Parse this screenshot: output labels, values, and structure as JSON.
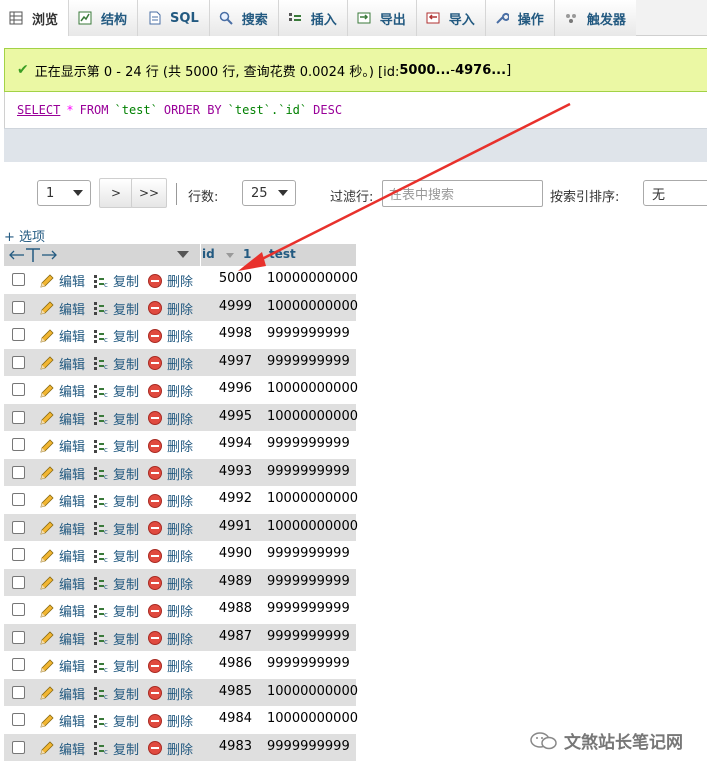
{
  "tabs": [
    {
      "label": "浏览",
      "icon": "browse-icon",
      "active": true
    },
    {
      "label": "结构",
      "icon": "structure-icon"
    },
    {
      "label": "SQL",
      "icon": "sql-icon"
    },
    {
      "label": "搜索",
      "icon": "search-icon"
    },
    {
      "label": "插入",
      "icon": "insert-icon"
    },
    {
      "label": "导出",
      "icon": "export-icon"
    },
    {
      "label": "导入",
      "icon": "import-icon"
    },
    {
      "label": "操作",
      "icon": "wrench-icon"
    },
    {
      "label": "触发器",
      "icon": "trigger-icon"
    }
  ],
  "message": {
    "prefix": "正在显示第 0 - 24 行 (共 5000 行, 查询花费 0.0024 秒。) [id: ",
    "bold1": "5000...",
    "middle": " - ",
    "bold2": "4976...",
    "suffix": "]"
  },
  "sql": {
    "select": "SELECT",
    "star": "*",
    "from": "FROM",
    "table": "`test`",
    "order": "ORDER BY",
    "column": "`test`.`id`",
    "desc": "DESC"
  },
  "nav": {
    "page_value": "1",
    "next_label": ">",
    "last_label": ">>",
    "rows_label": "行数:",
    "rows_value": "25",
    "filter_label": "过滤行:",
    "filter_placeholder": "在表中搜索",
    "sort_label": "按索引排序:",
    "sort_value": "无"
  },
  "options_label": "+ 选项",
  "table": {
    "col_id": "id",
    "col_id_sort": "1",
    "col_test": "test",
    "actions": {
      "edit": "编辑",
      "copy": "复制",
      "delete": "删除"
    },
    "rows": [
      {
        "id": "5000",
        "test": "10000000000"
      },
      {
        "id": "4999",
        "test": "10000000000"
      },
      {
        "id": "4998",
        "test": "9999999999"
      },
      {
        "id": "4997",
        "test": "9999999999"
      },
      {
        "id": "4996",
        "test": "10000000000"
      },
      {
        "id": "4995",
        "test": "10000000000"
      },
      {
        "id": "4994",
        "test": "9999999999"
      },
      {
        "id": "4993",
        "test": "9999999999"
      },
      {
        "id": "4992",
        "test": "10000000000"
      },
      {
        "id": "4991",
        "test": "10000000000"
      },
      {
        "id": "4990",
        "test": "9999999999"
      },
      {
        "id": "4989",
        "test": "9999999999"
      },
      {
        "id": "4988",
        "test": "9999999999"
      },
      {
        "id": "4987",
        "test": "9999999999"
      },
      {
        "id": "4986",
        "test": "9999999999"
      },
      {
        "id": "4985",
        "test": "10000000000"
      },
      {
        "id": "4984",
        "test": "10000000000"
      },
      {
        "id": "4983",
        "test": "9999999999"
      }
    ]
  },
  "watermark": "文煞站长笔记网",
  "colors": {
    "link": "#235a81",
    "success_bg": "#ebf8a4",
    "arrow": "#e8312c"
  }
}
